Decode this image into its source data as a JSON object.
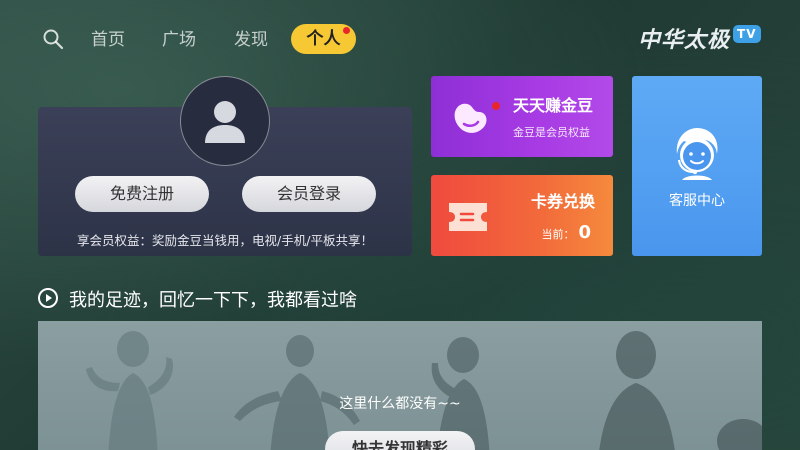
{
  "nav": {
    "items": [
      "首页",
      "广场",
      "发现"
    ],
    "active": "个人"
  },
  "logo": {
    "text": "中华太极",
    "badge": "TV"
  },
  "member": {
    "register_label": "免费注册",
    "login_label": "会员登录",
    "benefit": "享会员权益：奖励金豆当钱用，电视/手机/平板共享！"
  },
  "gold": {
    "title": "天天赚金豆",
    "subtitle": "金豆是会员权益"
  },
  "coupon": {
    "title": "卡券兑换",
    "current_label": "当前：",
    "count": "0"
  },
  "service": {
    "label": "客服中心"
  },
  "footprint": {
    "title": "我的足迹，回忆一下下，我都看过啥",
    "empty": "这里什么都没有~~",
    "discover_label": "快去发现精彩"
  },
  "colors": {
    "nav_active": "#f6c934",
    "gold_card": "#a83be4",
    "coupon_card": "#f26a3b",
    "service_card": "#5eaaf5",
    "badge_dot": "#e8262b"
  },
  "icons": [
    "search-icon",
    "avatar-icon",
    "bean-icon",
    "ticket-icon",
    "customer-service-icon",
    "play-circle-icon"
  ]
}
